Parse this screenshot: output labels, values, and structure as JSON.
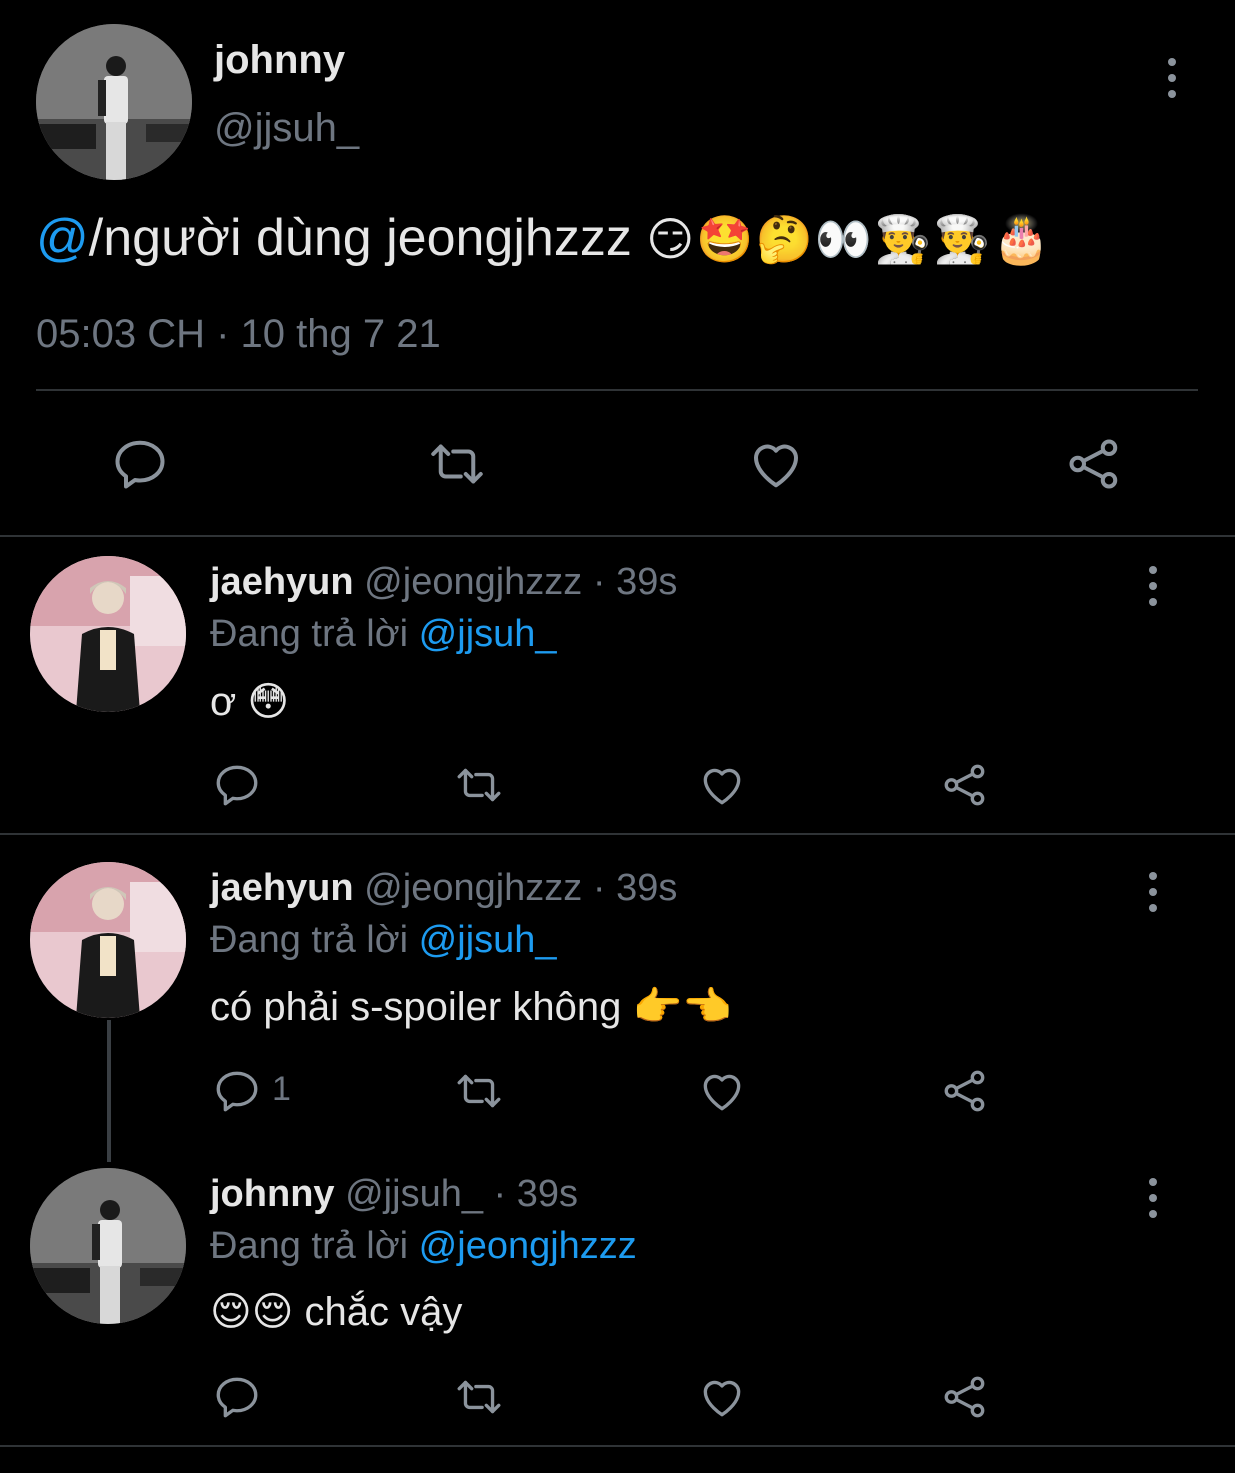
{
  "main_tweet": {
    "display_name": "johnny",
    "handle": "@jjsuh_",
    "text_at": "@",
    "text_rest": "/người dùng jeongjhzzz",
    "emojis": "😏🤩🤔👀👨‍🍳👨‍🍳🎂",
    "timestamp": "05:03 CH · 10 thg 7 21"
  },
  "replies": [
    {
      "display_name": "jaehyun",
      "meta": "@jeongjhzzz · 39s",
      "replying_prefix": "Đang trả lời",
      "replying_to": "@jjsuh_",
      "text": "ơ 😳",
      "reply_count": ""
    },
    {
      "display_name": "jaehyun",
      "meta": "@jeongjhzzz · 39s",
      "replying_prefix": "Đang trả lời",
      "replying_to": "@jjsuh_",
      "text": "có phải s-spoiler không 👉👈",
      "reply_count": "1"
    },
    {
      "display_name": "johnny",
      "meta": "@jjsuh_ · 39s",
      "replying_prefix": "Đang trả lời",
      "replying_to": "@jeongjhzzz",
      "text": "😌😌 chắc vậy",
      "reply_count": ""
    }
  ],
  "icons": {
    "reply": "speech-bubble-icon",
    "retweet": "retweet-icon",
    "like": "heart-icon",
    "share": "share-icon",
    "more": "more-vertical-icon"
  },
  "colors": {
    "background": "#000000",
    "link": "#1d9bf0",
    "muted": "#6e7681",
    "divider": "#2f3336"
  }
}
